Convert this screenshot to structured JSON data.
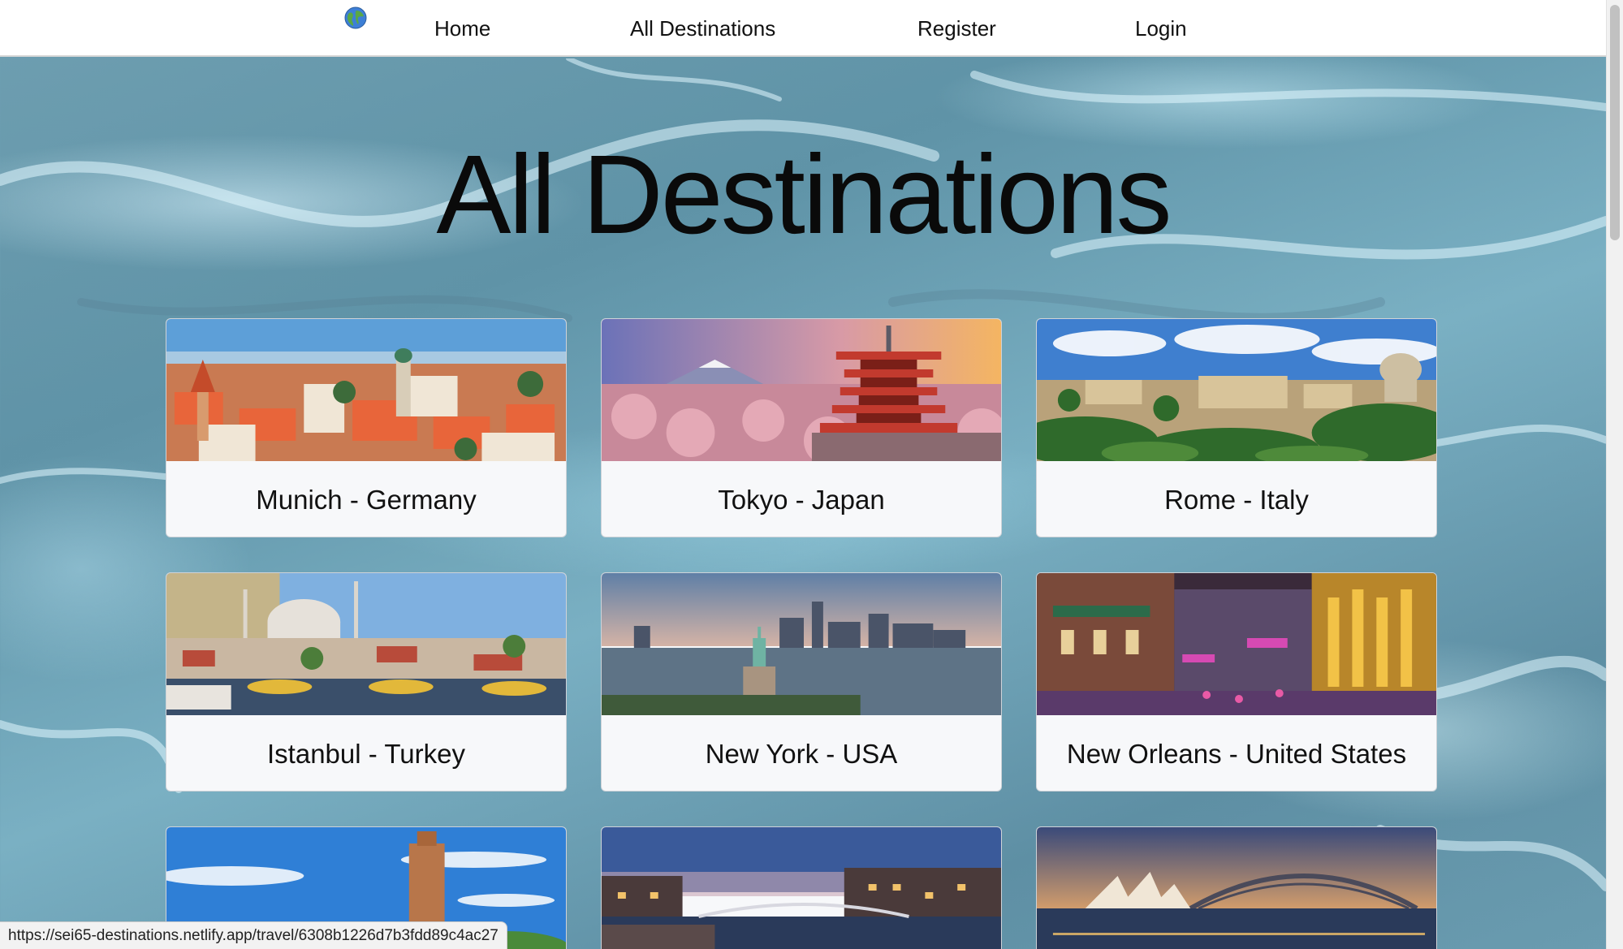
{
  "nav": {
    "logo_icon": "globe-icon",
    "items": [
      {
        "label": "Home"
      },
      {
        "label": "All Destinations"
      },
      {
        "label": "Register"
      },
      {
        "label": "Login"
      }
    ]
  },
  "page": {
    "title": "All Destinations"
  },
  "destinations": [
    {
      "title": "Munich - Germany",
      "image": "munich-photo"
    },
    {
      "title": "Tokyo - Japan",
      "image": "tokyo-photo"
    },
    {
      "title": "Rome - Italy",
      "image": "rome-photo"
    },
    {
      "title": "Istanbul - Turkey",
      "image": "istanbul-photo"
    },
    {
      "title": "New York - USA",
      "image": "new-york-photo"
    },
    {
      "title": "New Orleans - United States",
      "image": "new-orleans-photo"
    },
    {
      "title": "",
      "image": "minaret-photo"
    },
    {
      "title": "",
      "image": "river-city-photo"
    },
    {
      "title": "",
      "image": "sydney-photo"
    }
  ],
  "status_bar": {
    "url": "https://sei65-destinations.netlify.app/travel/6308b1226d7b3fdd89c4ac27"
  },
  "colors": {
    "background": "#6f9fb1",
    "card": "#f7f8fa",
    "navbar": "#ffffff"
  }
}
